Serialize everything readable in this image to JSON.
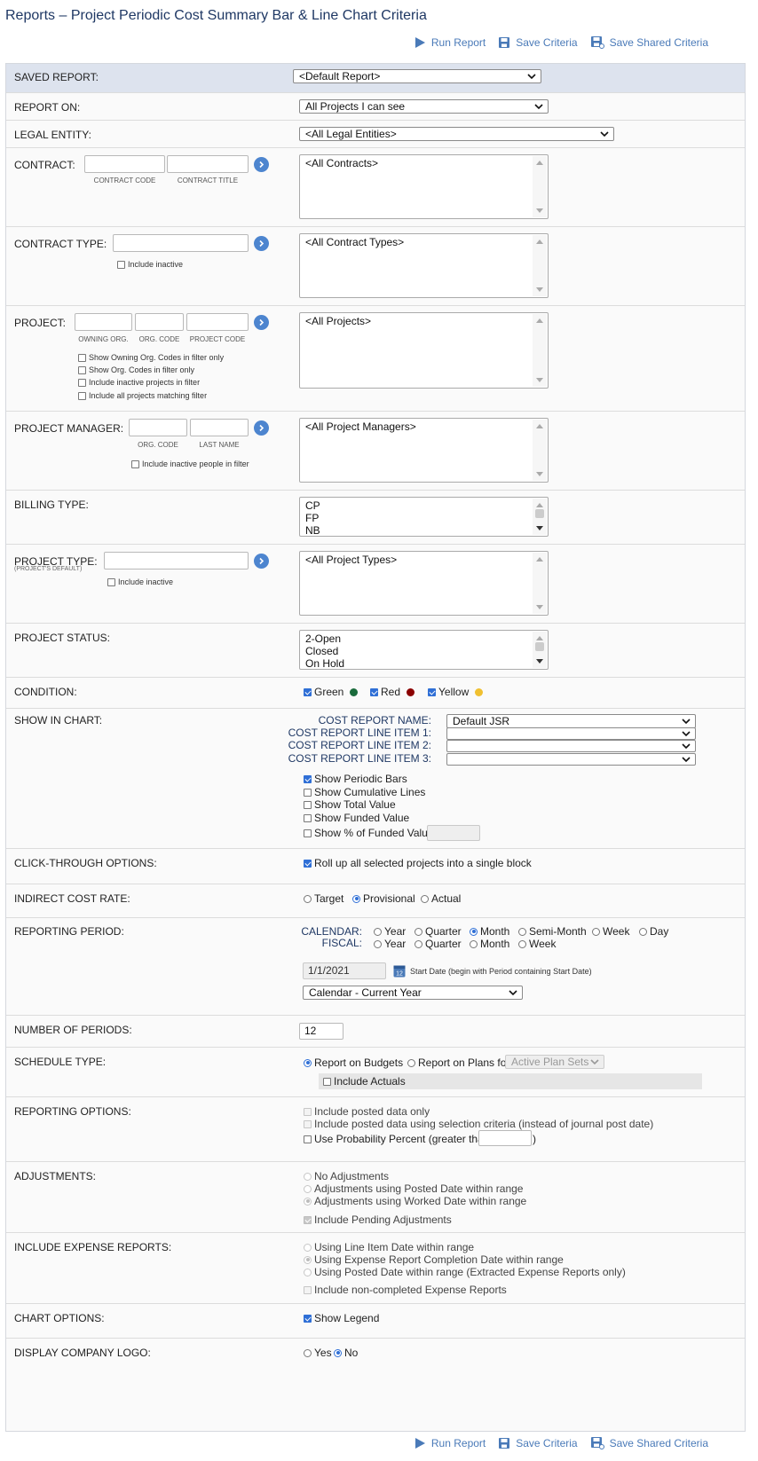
{
  "page_title": "Reports – Project Periodic Cost Summary Bar & Line Chart Criteria",
  "toolbar": {
    "run_report": "Run Report",
    "save_criteria": "Save Criteria",
    "save_shared_criteria": "Save Shared Criteria"
  },
  "saved_report": {
    "label": "SAVED REPORT:",
    "value": "<Default Report>"
  },
  "report_on": {
    "label": "REPORT ON:",
    "value": "All Projects I can see"
  },
  "legal_entity": {
    "label": "LEGAL ENTITY:",
    "value": "<All Legal Entities>"
  },
  "contract": {
    "label": "CONTRACT:",
    "code_caption": "CONTRACT CODE",
    "title_caption": "CONTRACT TITLE",
    "list": "<All Contracts>"
  },
  "contract_type": {
    "label": "CONTRACT TYPE:",
    "include_inactive": "Include inactive",
    "list": "<All Contract Types>"
  },
  "project": {
    "label": "PROJECT:",
    "owning_org_caption": "OWNING ORG.",
    "org_code_caption": "ORG. CODE",
    "project_code_caption": "PROJECT CODE",
    "opt1": "Show Owning Org. Codes in filter only",
    "opt2": "Show Org. Codes in filter only",
    "opt3": "Include inactive projects in filter",
    "opt4": "Include all projects matching filter",
    "list": "<All Projects>"
  },
  "project_manager": {
    "label": "PROJECT MANAGER:",
    "org_code_caption": "ORG. CODE",
    "last_name_caption": "LAST NAME",
    "include_inactive": "Include inactive people in filter",
    "list": "<All Project Managers>"
  },
  "billing_type": {
    "label": "BILLING TYPE:",
    "items": [
      "CP",
      "FP",
      "NB"
    ]
  },
  "project_type": {
    "label": "PROJECT TYPE:",
    "sublabel": "(PROJECT'S DEFAULT)",
    "include_inactive": "Include inactive",
    "list": "<All Project Types>"
  },
  "project_status": {
    "label": "PROJECT STATUS:",
    "items": [
      "2-Open",
      "Closed",
      "On Hold"
    ]
  },
  "condition": {
    "label": "CONDITION:",
    "green": "Green",
    "red": "Red",
    "yellow": "Yellow",
    "colors": {
      "green": "#1a6b3c",
      "red": "#8b0000",
      "yellow": "#f0c030"
    }
  },
  "show_in_chart": {
    "label": "SHOW IN CHART:",
    "cost_report_name_label": "COST REPORT NAME:",
    "cost_report_name": "Default JSR",
    "line_item_1_label": "COST REPORT LINE ITEM 1:",
    "line_item_2_label": "COST REPORT LINE ITEM 2:",
    "line_item_3_label": "COST REPORT LINE ITEM 3:",
    "periodic_bars": "Show Periodic Bars",
    "cumulative_lines": "Show Cumulative Lines",
    "total_value": "Show Total Value",
    "funded_value": "Show Funded Value",
    "pct_funded_value": "Show % of Funded Value"
  },
  "click_through": {
    "label": "CLICK-THROUGH OPTIONS:",
    "rollup": "Roll up all selected projects into a single block"
  },
  "indirect_cost_rate": {
    "label": "INDIRECT COST RATE:",
    "target": "Target",
    "provisional": "Provisional",
    "actual": "Actual"
  },
  "reporting_period": {
    "label": "REPORTING PERIOD:",
    "calendar_label": "CALENDAR:",
    "fiscal_label": "FISCAL:",
    "year": "Year",
    "quarter": "Quarter",
    "month": "Month",
    "semi_month": "Semi-Month",
    "week": "Week",
    "day": "Day",
    "start_date": "1/1/2021",
    "calendar_icon_day": "12",
    "start_date_hint": "Start Date (begin with Period containing Start Date)",
    "range": "Calendar - Current Year"
  },
  "number_of_periods": {
    "label": "NUMBER OF PERIODS:",
    "value": "12"
  },
  "schedule_type": {
    "label": "SCHEDULE TYPE:",
    "budgets": "Report on Budgets",
    "plans": "Report on Plans for",
    "plan_sets": "Active Plan Sets",
    "include_actuals": "Include Actuals"
  },
  "reporting_options": {
    "label": "REPORTING OPTIONS:",
    "posted_only": "Include posted data only",
    "posted_criteria": "Include posted data using selection criteria (instead of journal post date)",
    "probability": "Use Probability Percent (greater than",
    "probability_close": ")"
  },
  "adjustments": {
    "label": "ADJUSTMENTS:",
    "none": "No Adjustments",
    "posted": "Adjustments using Posted Date within range",
    "worked": "Adjustments using Worked Date within range",
    "pending": "Include Pending Adjustments"
  },
  "expense_reports": {
    "label": "INCLUDE EXPENSE REPORTS:",
    "line_item": "Using Line Item Date within range",
    "completion": "Using Expense Report Completion Date within range",
    "posted": "Using Posted Date within range (Extracted Expense Reports only)",
    "non_completed": "Include non-completed Expense Reports"
  },
  "chart_options": {
    "label": "CHART OPTIONS:",
    "show_legend": "Show Legend"
  },
  "company_logo": {
    "label": "DISPLAY COMPANY LOGO:",
    "yes": "Yes",
    "no": "No"
  }
}
